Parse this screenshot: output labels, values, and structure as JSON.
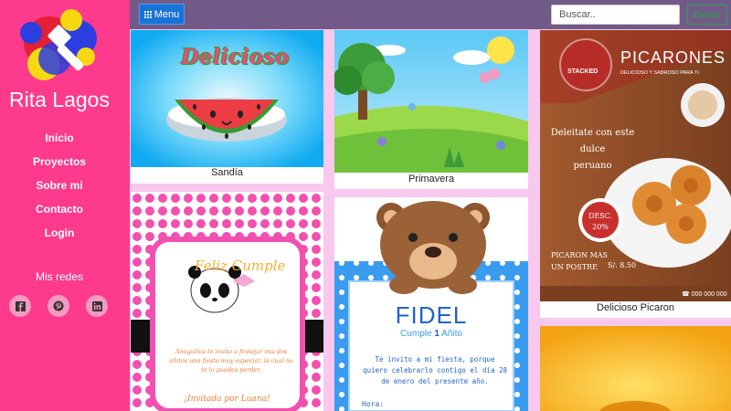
{
  "brand": {
    "name": "Rita Lagos"
  },
  "nav": {
    "items": [
      "Inicio",
      "Proyectos",
      "Sobre mi",
      "Contacto",
      "Login"
    ]
  },
  "social": {
    "title": "Mis redes",
    "icons": [
      "facebook-icon",
      "pinterest-icon",
      "linkedin-icon"
    ]
  },
  "topbar": {
    "menu_label": "Menu",
    "search_placeholder": "Buscar..",
    "search_button": "Buscar"
  },
  "cards": [
    {
      "caption": "Sandía",
      "image_text": "Delicioso"
    },
    {
      "caption": "Primavera"
    },
    {
      "caption": "Delicioso Picaron",
      "image_text": {
        "title": "PICARONES",
        "subtitle": "DELICIOSO Y SABROSO PARA TI",
        "logo": "STACKED",
        "tagline_1": "Deleitate con este dulce",
        "tagline_2": "peruano",
        "desc_1": "DESC.",
        "desc_2": "20%",
        "offer_1": "PICARON MAS",
        "offer_2": "UN POSTRE",
        "price": "S/. 8.50",
        "phone": "000 000 000"
      }
    },
    {
      "caption": "",
      "image_text": {
        "title": "Feliz Cumple",
        "body": "Amiguitos te invito a festejar mis dos añitos una fiesta muy especial, la cual no te lo puedes perder.",
        "sign": "¡Invitada por Luana!"
      }
    },
    {
      "caption": "",
      "image_text": {
        "name": "FIDEL",
        "age_pre": "Cumple",
        "age_num": "1",
        "age_post": "Añito",
        "body": "Te invito a mi fiesta, porque quiero celebrarlo contigo el día 28 de enero del presente año.",
        "hora": "Hora:"
      }
    },
    {
      "caption": ""
    }
  ],
  "colors": {
    "sidebar": "#fd3a8b",
    "topbar": "#725a88",
    "background": "#f9c8ef",
    "menu_button": "#1873d8",
    "search_button": "#28a745"
  }
}
